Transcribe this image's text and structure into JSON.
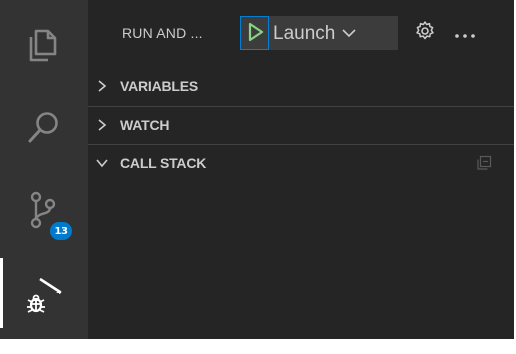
{
  "activity_bar": {
    "items": [
      {
        "name": "explorer",
        "icon": "files-icon"
      },
      {
        "name": "search",
        "icon": "search-icon"
      },
      {
        "name": "source-control",
        "icon": "source-control-icon",
        "badge": "13"
      },
      {
        "name": "run-and-debug",
        "icon": "run-debug-icon",
        "active": true
      }
    ]
  },
  "sidebar": {
    "title": "RUN AND ...",
    "launch_config": "Launch",
    "sections": [
      {
        "label": "VARIABLES",
        "expanded": false
      },
      {
        "label": "WATCH",
        "expanded": false
      },
      {
        "label": "CALL STACK",
        "expanded": true
      }
    ]
  },
  "colors": {
    "activity_bg": "#333333",
    "sidebar_bg": "#252526",
    "accent": "#007acc",
    "play_green": "#89d185",
    "text": "#cccccc"
  }
}
